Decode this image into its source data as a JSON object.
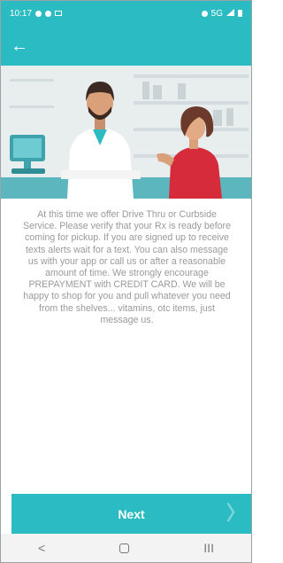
{
  "status_bar": {
    "time": "10:17",
    "network": "5G",
    "icons": [
      "notification-icon",
      "settings-icon",
      "image-icon",
      "alarm-icon",
      "signal-icon",
      "battery-icon"
    ]
  },
  "header": {
    "back_icon": "arrow-left-icon",
    "back_glyph": "←"
  },
  "hero": {
    "image_description": "pharmacist-and-customer-illustration"
  },
  "message": "At this time we offer Drive Thru or Curbside Service. Please verify that your Rx is ready before coming for pickup. If you are signed up to receive texts alerts wait for a text. You can also message us with your app or call us or after a reasonable amount of time. We strongly encourage PREPAYMENT with CREDIT CARD. We will be happy to shop for you and pull whatever you need from the shelves... vitamins, otc items, just message us.",
  "next_button": {
    "label": "Next",
    "chevron": "〉"
  },
  "navbar": {
    "back_glyph": "<",
    "recents_glyph": "III"
  },
  "colors": {
    "primary": "#2bbcc3",
    "text": "#9a9a9a"
  }
}
